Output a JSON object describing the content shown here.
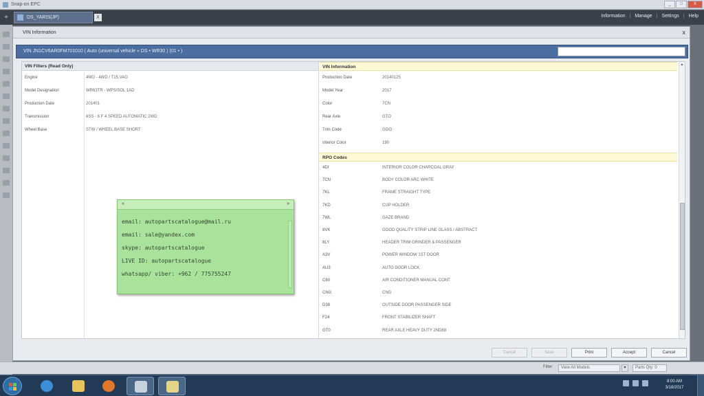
{
  "window": {
    "title": "Snap-on EPC",
    "btn_min": "_",
    "btn_max": "□",
    "btn_close": "X"
  },
  "appbar": {
    "home_icon": "+",
    "tab_label": "DS_YARIS(JP)",
    "tab_close": "X",
    "menu": [
      "Information",
      "Manage",
      "Settings",
      "Help"
    ],
    "separator": "|"
  },
  "dialog": {
    "title": "VIN Information",
    "close": "x",
    "vin_bar_text": "VIN  JN1CV6AR0FM701010  ( Auto (universal vehicle » DS  • WR30 )               (01 • )",
    "search_value": ""
  },
  "left_section": {
    "title": "VIN Filters (Read Only)",
    "rows": [
      {
        "key": "Engine",
        "value": "4MO - 4WD / T15.VAO"
      },
      {
        "key": "Model Designation",
        "value": "WR63TR - WPS/SOL 1AD"
      },
      {
        "key": "Production Date",
        "value": "201401"
      },
      {
        "key": "Transmission",
        "value": "6SS - 6 F 4 SPEED AUTOMATIC 2WD"
      },
      {
        "key": "Wheel Base",
        "value": "STW / WHEEL BASE SHORT"
      }
    ]
  },
  "vin_info": {
    "title": "VIN Information",
    "rows": [
      {
        "key": "Production Date",
        "value": "20140125"
      },
      {
        "key": "Model Year",
        "value": "2017"
      },
      {
        "key": "Color",
        "value": "7CN"
      },
      {
        "key": "Rear Axle",
        "value": "GTO"
      },
      {
        "key": "Trim Code",
        "value": "GOO"
      },
      {
        "key": "Interior Color",
        "value": "190"
      }
    ]
  },
  "rpo_codes": {
    "title": "RPO Codes",
    "rows": [
      {
        "key": "4DI",
        "value": "INTERIOR COLOR CHARCOAL GRAY"
      },
      {
        "key": "7CN",
        "value": "BODY COLOR ARC WHITE"
      },
      {
        "key": "7KL",
        "value": "FRAME STRAIGHT TYPE"
      },
      {
        "key": "7KD",
        "value": "CUP HOLDER"
      },
      {
        "key": "7WL",
        "value": "GAZE BRAND"
      },
      {
        "key": "8VK",
        "value": "GOOD QUALITY STRIP LINE GLASS / ABSTRACT"
      },
      {
        "key": "8LY",
        "value": "HEADER TRIM GRINDER & PASSENGER"
      },
      {
        "key": "A3V",
        "value": "POWER WINDOW 1ST DOOR"
      },
      {
        "key": "AU3",
        "value": "AUTO DOOR LOCK"
      },
      {
        "key": "C60",
        "value": "AIR CONDITIONER MANUAL CONT"
      },
      {
        "key": "CNG",
        "value": "CNG"
      },
      {
        "key": "D38",
        "value": "OUTSIDE DOOR PASSENGER SIDE"
      },
      {
        "key": "F24",
        "value": "FRONT STABILIZER SHAFT"
      },
      {
        "key": "GT0",
        "value": "REAR AXLE HEAVY DUTY 2ND88"
      }
    ]
  },
  "note": {
    "left_mark": "«",
    "right_mark": "»",
    "lines": [
      "email: autopartscatalogue@mail.ru",
      "email: sale@yandex.com",
      "skype: autopartscatalogue",
      "LIVE ID: autopartscatalogue",
      "whatsapp/ viber: +962 / 775755247"
    ]
  },
  "buttons": {
    "cancel_dim": "Cancel",
    "save_dim": "Save",
    "print": "Print",
    "accept": "Accept",
    "close": "Cancel"
  },
  "statusbar": {
    "label": "Filter",
    "field1": "View All Models",
    "arrow": "▾",
    "field2": "Parts Qty: 0"
  },
  "taskbar": {
    "time": "8:00 AM",
    "date": "3/18/2017"
  },
  "colors": {
    "accent": "#4b6da0",
    "note_bg": "#a9e39b",
    "section_highlight": "#fdf8d6"
  }
}
